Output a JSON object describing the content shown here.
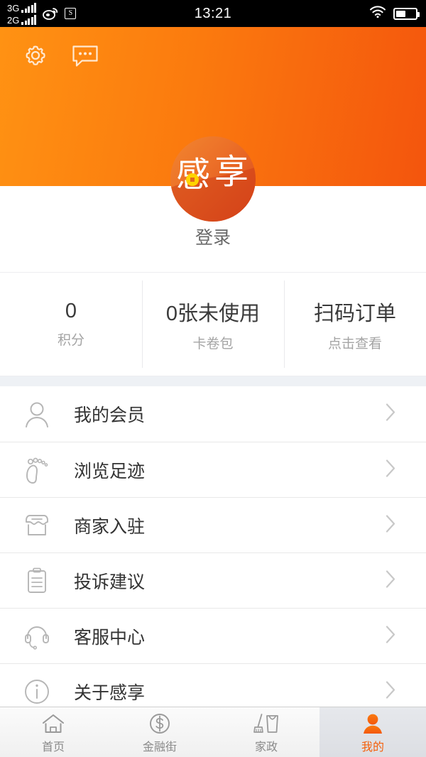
{
  "status_bar": {
    "network_rows": [
      {
        "label": "3G",
        "icon": "signal-bars-icon"
      },
      {
        "label": "2G",
        "icon": "signal-bars-icon"
      }
    ],
    "weibo_icon": "weibo-icon",
    "app_box_icon_letter": "S",
    "time": "13:21",
    "wifi_icon": "wifi-icon",
    "battery_icon": "battery-icon"
  },
  "header": {
    "settings_icon": "gear-icon",
    "message_icon": "message-bubble-icon",
    "brand_colors": {
      "start": "#ff9213",
      "end": "#f4550d"
    }
  },
  "profile": {
    "logo_text": "感享",
    "login_label": "登录"
  },
  "stats": [
    {
      "value": "0",
      "label": "积分",
      "name": "points"
    },
    {
      "value": "0张未使用",
      "label": "卡卷包",
      "name": "coupons"
    },
    {
      "value": "扫码订单",
      "label": "点击查看",
      "name": "scan-order"
    }
  ],
  "menu": [
    {
      "label": "我的会员",
      "icon": "person-icon",
      "name": "my-membership"
    },
    {
      "label": "浏览足迹",
      "icon": "footprint-icon",
      "name": "browsing-history"
    },
    {
      "label": "商家入驻",
      "icon": "shop-icon",
      "name": "merchant-settlement"
    },
    {
      "label": "投诉建议",
      "icon": "clipboard-icon",
      "name": "complaints-suggestions"
    },
    {
      "label": "客服中心",
      "icon": "headset-icon",
      "name": "customer-service"
    },
    {
      "label": "关于感享",
      "icon": "info-circle-icon",
      "name": "about-ganxiang"
    }
  ],
  "tabs": [
    {
      "label": "首页",
      "icon": "home-icon",
      "active": false,
      "name": "home"
    },
    {
      "label": "金融街",
      "icon": "dollar-circle-icon",
      "active": false,
      "name": "finance-street"
    },
    {
      "label": "家政",
      "icon": "housekeeping-icon",
      "active": false,
      "name": "housekeeping"
    },
    {
      "label": "我的",
      "icon": "person-filled-icon",
      "active": true,
      "name": "mine"
    }
  ],
  "theme": {
    "accent": "#f4600c",
    "menu_icon_color": "#b3b3b3",
    "chevron_color": "#c8c8c8"
  }
}
